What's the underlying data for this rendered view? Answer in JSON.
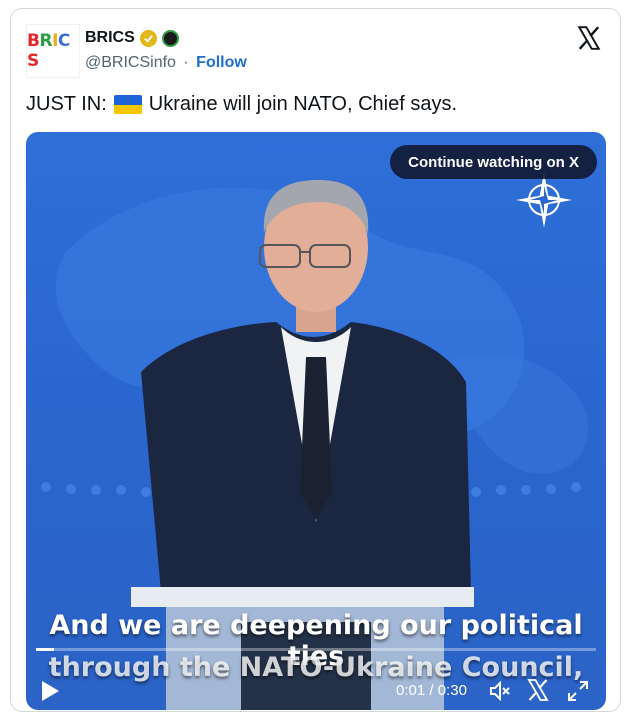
{
  "account": {
    "display_name": "BRICS",
    "handle": "@BRICSinfo",
    "separator": "·",
    "follow_label": "Follow",
    "avatar_letters": [
      "B",
      "R",
      "I",
      "C",
      "S"
    ],
    "avatar_colors": [
      "#e3262b",
      "#2a9d43",
      "#f0a81d",
      "#3b6fd1",
      "#e3262b"
    ]
  },
  "tweet": {
    "prefix": "JUST IN:",
    "flag_icon": "ukraine-flag-icon",
    "body": "Ukraine will join NATO, Chief says."
  },
  "video": {
    "continue_label": "Continue watching on X",
    "subtitle_line1": "And we are deepening our political ties",
    "subtitle_line2": "through the NATO-Ukraine Council,",
    "current_time": "0:01",
    "time_separator": "/",
    "duration": "0:30",
    "progress_fraction": 0.033
  },
  "colors": {
    "follow": "#1d6fc9",
    "verified": "#e2b719",
    "video_bg": "#2b66cf"
  }
}
